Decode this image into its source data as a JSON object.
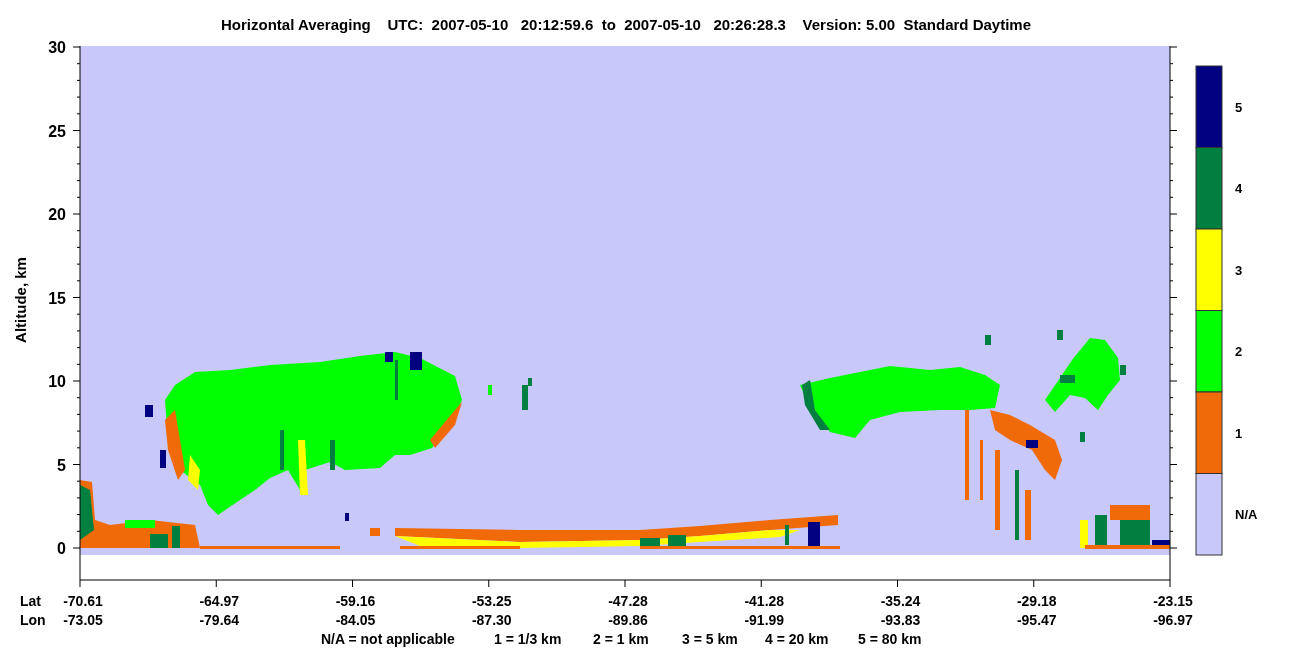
{
  "title": "Horizontal Averaging    UTC:  2007-05-10   20:12:59.6  to  2007-05-10   20:26:28.3    Version: 5.00  Standard Daytime",
  "y_axis": {
    "label": "Altitude, km",
    "ticks": [
      "30",
      "25",
      "20",
      "15",
      "10",
      "5",
      "0"
    ]
  },
  "x_axis": {
    "row_labels": [
      "Lat",
      "Lon"
    ],
    "columns": [
      {
        "lat": "-70.61",
        "lon": "-73.05"
      },
      {
        "lat": "-64.97",
        "lon": "-79.64"
      },
      {
        "lat": "-59.16",
        "lon": "-84.05"
      },
      {
        "lat": "-53.25",
        "lon": "-87.30"
      },
      {
        "lat": "-47.28",
        "lon": "-89.86"
      },
      {
        "lat": "-41.28",
        "lon": "-91.99"
      },
      {
        "lat": "-35.24",
        "lon": "-93.83"
      },
      {
        "lat": "-29.18",
        "lon": "-95.47"
      },
      {
        "lat": "-23.15",
        "lon": "-96.97"
      }
    ]
  },
  "colorbar": [
    {
      "label": "5",
      "color": "#000080"
    },
    {
      "label": "4",
      "color": "#008040"
    },
    {
      "label": "3",
      "color": "#ffff00"
    },
    {
      "label": "2",
      "color": "#00ff00"
    },
    {
      "label": "1",
      "color": "#f06a0a"
    },
    {
      "label": "N/A",
      "color": "#c8c8fa"
    }
  ],
  "legend": [
    "N/A = not applicable",
    "1 = 1/3 km",
    "2 = 1 km",
    "3 = 5 km",
    "4 = 20 km",
    "5 = 80 km"
  ]
}
